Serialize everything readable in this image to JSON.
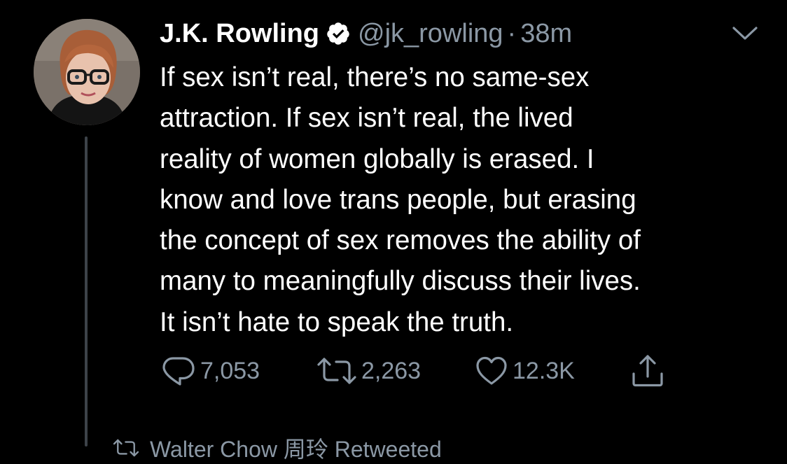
{
  "tweet": {
    "author_name": "J.K. Rowling",
    "author_handle": "@jk_rowling",
    "separator": "·",
    "time": "38m",
    "text_lines": [
      "If sex isn’t real, there’s no same-sex",
      "attraction. If sex isn’t real, the lived",
      "reality of women globally is erased. I",
      "know and love trans people, but erasing",
      "the concept of sex removes the ability of",
      "many to meaningfully discuss their lives.",
      "It isn’t hate to speak the truth."
    ],
    "reply_count": "7,053",
    "retweet_count": "2,263",
    "like_count": "12.3K"
  },
  "next_item": {
    "text": "Walter Chow 周玲 Retweeted"
  },
  "icons": {
    "verified": "verified-badge-icon",
    "caret": "chevron-down-icon",
    "reply": "reply-icon",
    "retweet": "retweet-icon",
    "like": "heart-icon",
    "share": "share-icon"
  },
  "colors": {
    "background": "#000000",
    "text": "#ffffff",
    "secondary": "#8b98a5",
    "thread_line": "#3d4349"
  }
}
